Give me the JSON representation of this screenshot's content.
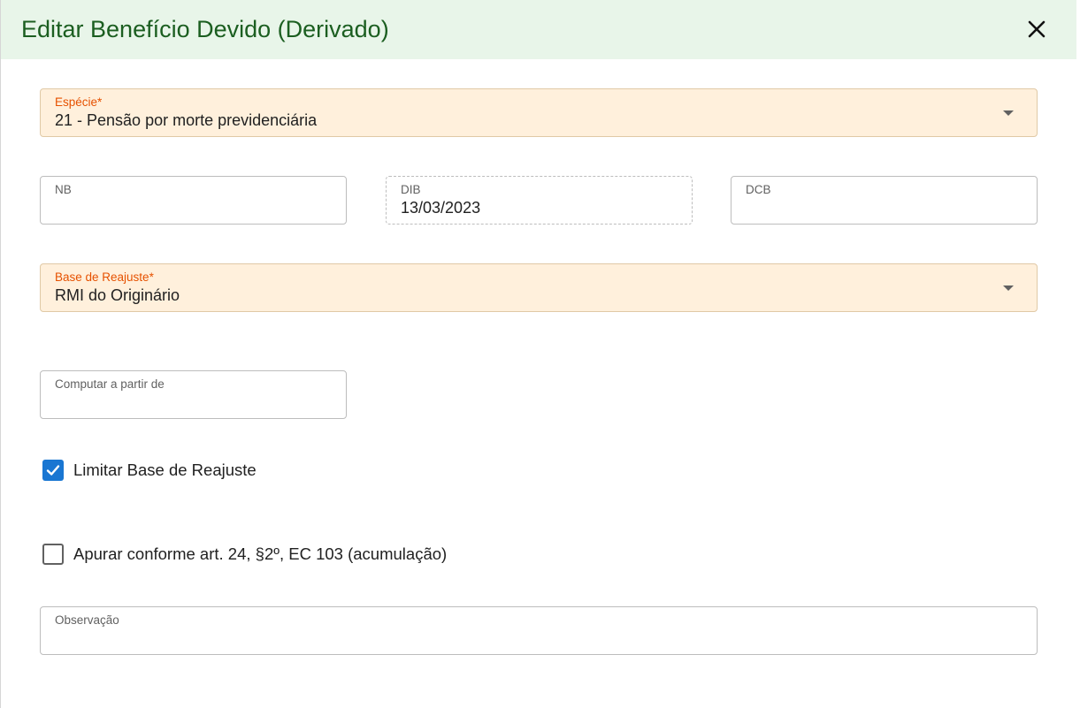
{
  "dialog": {
    "title": "Editar Benefício Devido (Derivado)",
    "close_icon": "close-icon"
  },
  "fields": {
    "especie": {
      "label": "Espécie*",
      "value": "21 - Pensão por morte previdenciária"
    },
    "nb": {
      "label": "NB",
      "value": ""
    },
    "dib": {
      "label": "DIB",
      "value": "13/03/2023"
    },
    "dcb": {
      "label": "DCB",
      "value": ""
    },
    "base_reajuste": {
      "label": "Base de Reajuste*",
      "value": "RMI do Originário"
    },
    "computar": {
      "label": "Computar a partir de",
      "value": ""
    },
    "observacao": {
      "label": "Observação",
      "value": ""
    }
  },
  "checkboxes": {
    "limitar": {
      "label": "Limitar Base de Reajuste",
      "checked": true
    },
    "apurar": {
      "label": "Apurar conforme art. 24, §2º, EC 103 (acumulação)",
      "checked": false
    }
  },
  "colors": {
    "header_bg": "#e8f5e9",
    "title": "#1b5e20",
    "required_field_bg": "#fff0dc",
    "required_label": "#e65100",
    "checkbox_accent": "#1976d2"
  }
}
